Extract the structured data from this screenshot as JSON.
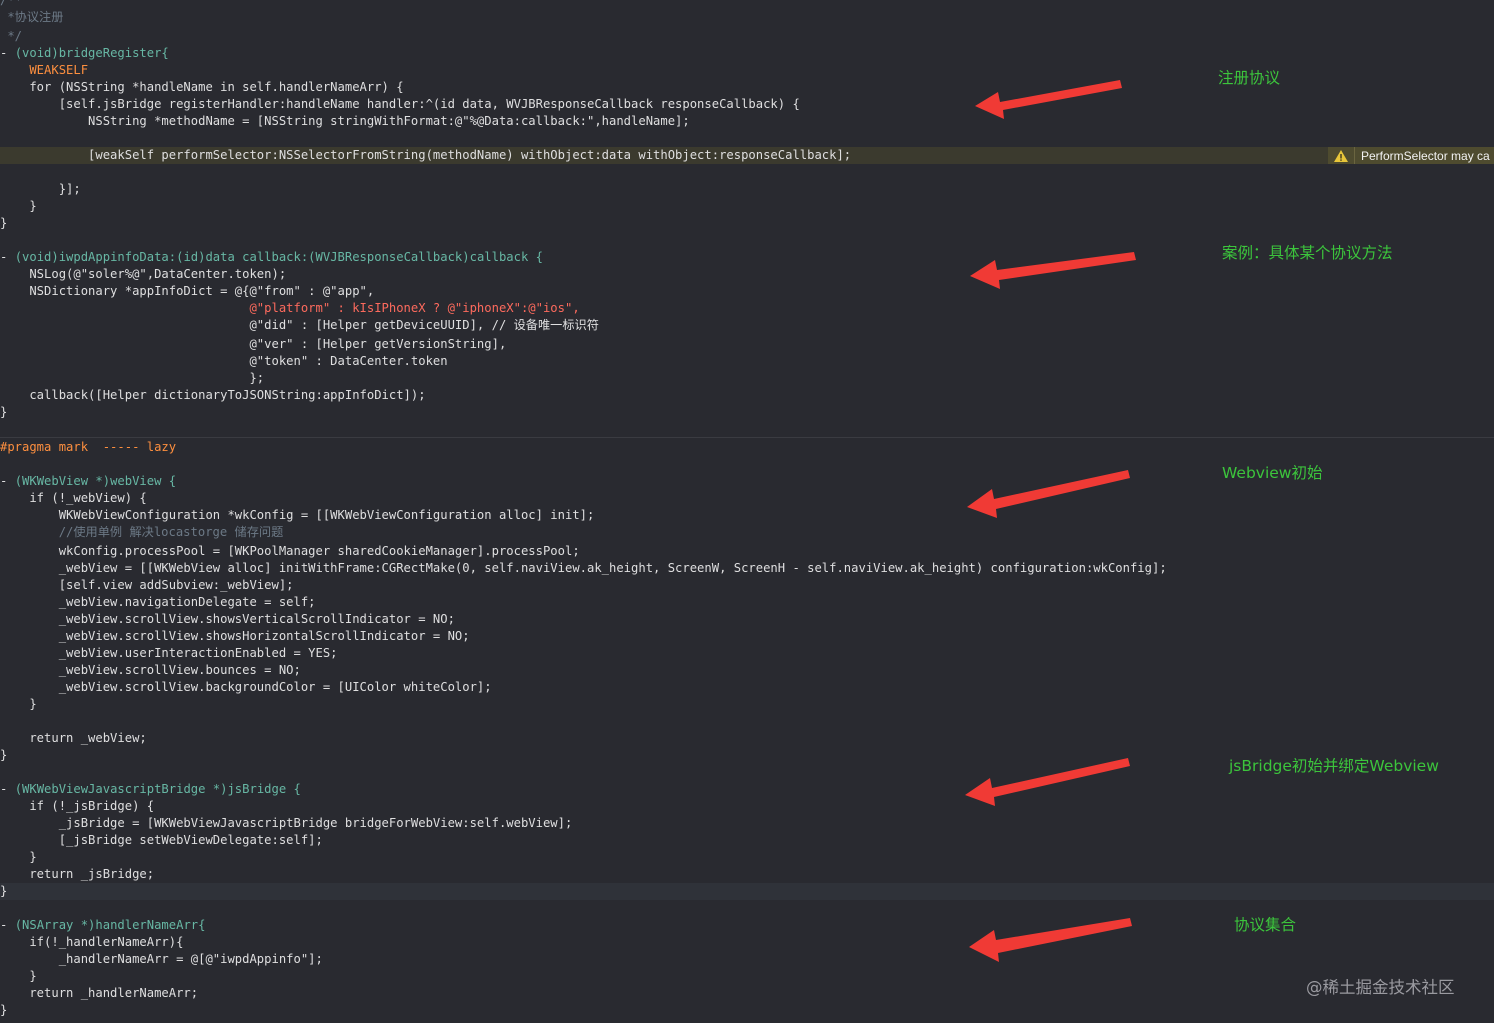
{
  "header_comment": {
    "top_fragment": "/**",
    "title": " *协议注册",
    "close": " */"
  },
  "code": {
    "bridge_register": {
      "l1": "(void)bridgeRegister{",
      "l2": "    WEAKSELF",
      "l3_a": "    for (NSString *handleName in self.handlerNameArr) {",
      "l4": "        [self.jsBridge registerHandler:handleName handler:^(id data, WVJBResponseCallback responseCallback) {",
      "l5": "            NSString *methodName = [NSString stringWithFormat:@\"%@Data:callback:\",handleName];",
      "l6": "            [weakSelf performSelector:NSSelectorFromString(methodName) withObject:data withObject:responseCallback];",
      "l7": "        }];",
      "l8": "    }",
      "l9": "}"
    },
    "appinfo": {
      "l1": "(void)iwpdAppinfoData:(id)data callback:(WVJBResponseCallback)callback {",
      "l2": "    NSLog(@\"soler%@\",DataCenter.token);",
      "l3": "    NSDictionary *appInfoDict = @{@\"from\" : @\"app\",",
      "l4": "                                  @\"platform\" : kIsIPhoneX ? @\"iphoneX\":@\"ios\",",
      "l5": "                                  @\"did\" : [Helper getDeviceUUID], // 设备唯一标识符",
      "l6": "                                  @\"ver\" : [Helper getVersionString],",
      "l7": "                                  @\"token\" : DataCenter.token",
      "l8": "                                  };",
      "l9": "    callback([Helper dictionaryToJSONString:appInfoDict]);",
      "l10": "}"
    },
    "pragma": "#pragma mark  ----- lazy",
    "webview": {
      "l1": "(WKWebView *)webView {",
      "l2": "    if (!_webView) {",
      "l3": "        WKWebViewConfiguration *wkConfig = [[WKWebViewConfiguration alloc] init];",
      "l4": "        //使用单例 解决locastorge 储存问题",
      "l5": "        wkConfig.processPool = [WKPoolManager sharedCookieManager].processPool;",
      "l6": "        _webView = [[WKWebView alloc] initWithFrame:CGRectMake(0, self.naviView.ak_height, ScreenW, ScreenH - self.naviView.ak_height) configuration:wkConfig];",
      "l7": "        [self.view addSubview:_webView];",
      "l8": "        _webView.navigationDelegate = self;",
      "l9": "        _webView.scrollView.showsVerticalScrollIndicator = NO;",
      "l10": "        _webView.scrollView.showsHorizontalScrollIndicator = NO;",
      "l11": "        _webView.userInteractionEnabled = YES;",
      "l12": "        _webView.scrollView.bounces = NO;",
      "l13": "        _webView.scrollView.backgroundColor = [UIColor whiteColor];",
      "l14": "    }",
      "l15": "    return _webView;",
      "l16": "}"
    },
    "jsbridge": {
      "l1": "(WKWebViewJavascriptBridge *)jsBridge {",
      "l2": "    if (!_jsBridge) {",
      "l3": "        _jsBridge = [WKWebViewJavascriptBridge bridgeForWebView:self.webView];",
      "l4": "        [_jsBridge setWebViewDelegate:self];",
      "l5": "    }",
      "l6": "    return _jsBridge;",
      "l7": "}"
    },
    "handlers": {
      "l1": "(NSArray *)handlerNameArr{",
      "l2": "    if(!_handlerNameArr){",
      "l3": "        _handlerNameArr = @[@\"iwpdAppinfo\"];",
      "l4": "    }",
      "l5": "    return _handlerNameArr;",
      "l6": "}"
    },
    "method_marker": "-"
  },
  "warning": {
    "icon": "warning-triangle-icon",
    "text": "PerformSelector may ca",
    "color": "#d0bf69"
  },
  "annotations": {
    "register": "注册协议",
    "example": "案例：具体某个协议方法",
    "webview_init": "Webview初始",
    "jsbridge_init": "jsBridge初始并绑定Webview",
    "collection": "协议集合",
    "color": "#3cc43c"
  },
  "arrow_color": "#f03a35",
  "watermark": "@稀土掘金技术社区"
}
